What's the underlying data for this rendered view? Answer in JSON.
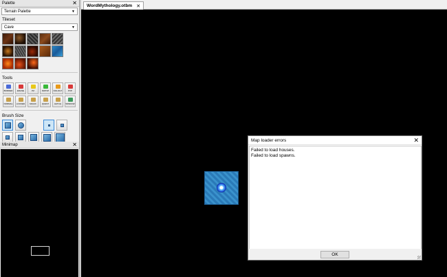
{
  "palette": {
    "title": "Palette",
    "palette_type": "Terrain Palette",
    "tileset_label": "Tileset",
    "tileset_value": "Cave",
    "tools_label": "Tools",
    "tools": [
      {
        "label": "BORDER",
        "color": "#4a6ad8"
      },
      {
        "label": "ERASE",
        "color": "#d83a3a"
      },
      {
        "label": "PZ",
        "color": "#e8c81a"
      },
      {
        "label": "NOPVP",
        "color": "#3ab83a"
      },
      {
        "label": "NOLOGT",
        "color": "#e89a1a"
      },
      {
        "label": "PVP",
        "color": "#d83a3a"
      },
      {
        "label": "NORMAL",
        "color": "#c8a04a"
      },
      {
        "label": "LOCKED",
        "color": "#c8a04a"
      },
      {
        "label": "MAGIC",
        "color": "#c8a04a"
      },
      {
        "label": "QUEST",
        "color": "#c8a04a"
      },
      {
        "label": "HATCH",
        "color": "#c8a04a"
      },
      {
        "label": "WINDOW",
        "color": "#3a9a5a"
      }
    ],
    "brush_size_label": "Brush Size"
  },
  "minimap": {
    "title": "Minimap"
  },
  "editor": {
    "tab_label": "WordMythology.otbm"
  },
  "dialog": {
    "title": "Map loader errors",
    "lines": [
      "Failed to load houses.",
      "Failed to load spawns."
    ],
    "ok_label": "OK"
  }
}
